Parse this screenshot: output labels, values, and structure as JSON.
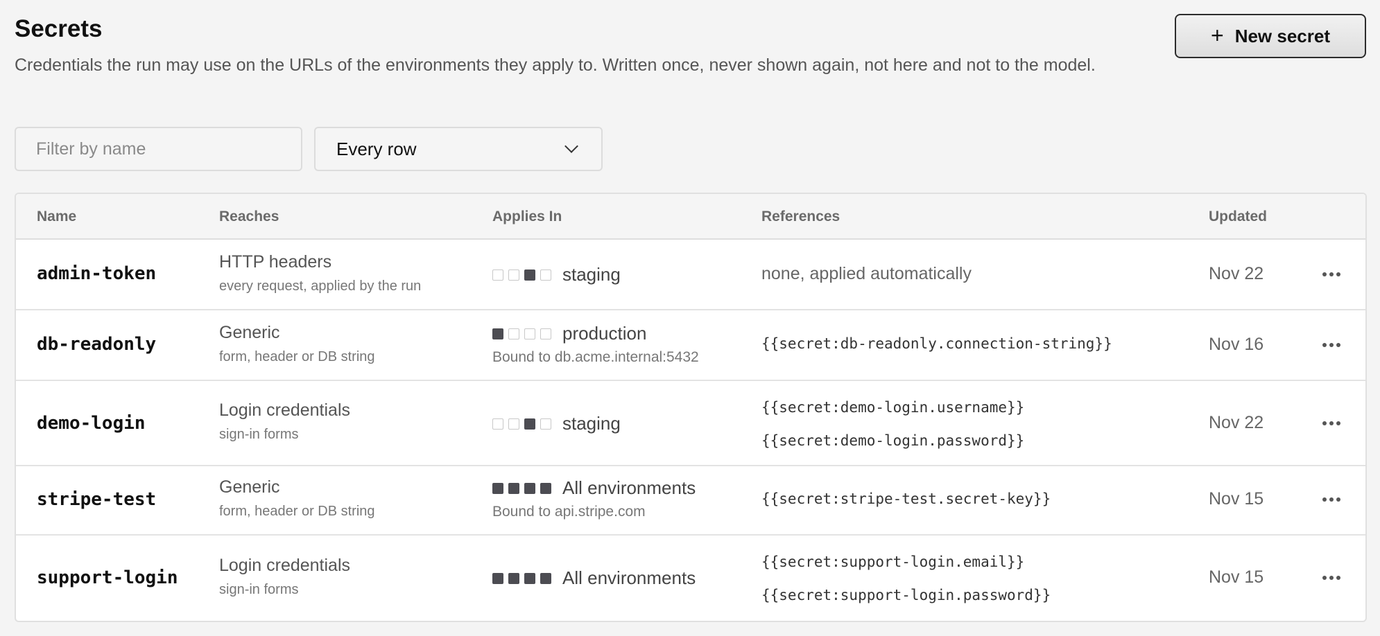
{
  "header": {
    "title": "Secrets",
    "description": "Credentials the run may use on the URLs of the environments they apply to. Written once, never shown again, not here and not to the model.",
    "new_button_label": "New secret",
    "new_button_icon": "plus-icon"
  },
  "filters": {
    "name_placeholder": "Filter by name",
    "row_select_value": "Every row"
  },
  "table": {
    "columns": {
      "name": "Name",
      "reaches": "Reaches",
      "applies_in": "Applies In",
      "references": "References",
      "updated": "Updated"
    },
    "rows": [
      {
        "name": "admin-token",
        "reach": "HTTP headers",
        "reach_detail": "every request, applied by the run",
        "env_squares": [
          false,
          false,
          true,
          false
        ],
        "env": "staging",
        "env_detail": "",
        "references_text": "none, applied automatically",
        "references": [],
        "updated": "Nov 22"
      },
      {
        "name": "db-readonly",
        "reach": "Generic",
        "reach_detail": "form, header or DB string",
        "env_squares": [
          true,
          false,
          false,
          false
        ],
        "env": "production",
        "env_detail": "Bound to db.acme.internal:5432",
        "references_text": "",
        "references": [
          "{{secret:db-readonly.connection-string}}"
        ],
        "updated": "Nov 16"
      },
      {
        "name": "demo-login",
        "reach": "Login credentials",
        "reach_detail": "sign-in forms",
        "env_squares": [
          false,
          false,
          true,
          false
        ],
        "env": "staging",
        "env_detail": "",
        "references_text": "",
        "references": [
          "{{secret:demo-login.username}}",
          "{{secret:demo-login.password}}"
        ],
        "updated": "Nov 22"
      },
      {
        "name": "stripe-test",
        "reach": "Generic",
        "reach_detail": "form, header or DB string",
        "env_squares": [
          true,
          true,
          true,
          true
        ],
        "env": "All environments",
        "env_detail": "Bound to api.stripe.com",
        "references_text": "",
        "references": [
          "{{secret:stripe-test.secret-key}}"
        ],
        "updated": "Nov 15"
      },
      {
        "name": "support-login",
        "reach": "Login credentials",
        "reach_detail": "sign-in forms",
        "env_squares": [
          true,
          true,
          true,
          true
        ],
        "env": "All environments",
        "env_detail": "",
        "references_text": "",
        "references": [
          "{{secret:support-login.email}}",
          "{{secret:support-login.password}}"
        ],
        "updated": "Nov 15"
      }
    ]
  }
}
